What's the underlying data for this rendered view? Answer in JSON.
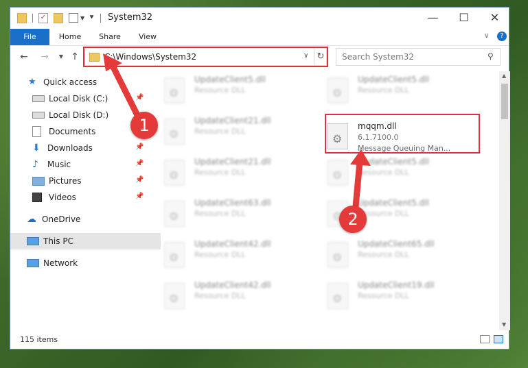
{
  "window": {
    "title": "System32",
    "tabs": [
      "File",
      "Home",
      "Share",
      "View"
    ]
  },
  "address": {
    "path": "C:\\Windows\\System32",
    "search_placeholder": "Search System32"
  },
  "nav": {
    "items": [
      {
        "label": "Quick access",
        "icon": "star-icon"
      },
      {
        "label": "Local Disk (C:)",
        "icon": "drive-icon"
      },
      {
        "label": "Local Disk (D:)",
        "icon": "drive-icon"
      },
      {
        "label": "Documents",
        "icon": "documents-icon"
      },
      {
        "label": "Downloads",
        "icon": "download-icon"
      },
      {
        "label": "Music",
        "icon": "music-icon"
      },
      {
        "label": "Pictures",
        "icon": "pictures-icon"
      },
      {
        "label": "Videos",
        "icon": "videos-icon"
      },
      {
        "label": "OneDrive",
        "icon": "cloud-icon"
      },
      {
        "label": "This PC",
        "icon": "computer-icon"
      },
      {
        "label": "Network",
        "icon": "network-icon"
      }
    ]
  },
  "files": {
    "left": [
      {
        "name": "UpdateClient5.dll",
        "type": "Resource DLL"
      },
      {
        "name": "UpdateClient21.dll",
        "type": "Resource DLL"
      },
      {
        "name": "UpdateClient21.dll",
        "type": "Resource DLL"
      },
      {
        "name": "UpdateClient63.dll",
        "type": "Resource DLL"
      },
      {
        "name": "UpdateClient42.dll",
        "type": "Resource DLL"
      },
      {
        "name": "UpdateClient42.dll",
        "type": "Resource DLL"
      }
    ],
    "right": [
      {
        "name": "UpdateClient5.dll",
        "type": "Resource DLL"
      },
      {
        "name": "UpdateClient5.dll",
        "type": "Resource DLL"
      },
      {
        "name": "UpdateClient5.dll",
        "type": "Resource DLL"
      },
      {
        "name": "UpdateClient65.dll",
        "type": "Resource DLL"
      },
      {
        "name": "UpdateClient19.dll",
        "type": "Resource DLL"
      }
    ],
    "selected": {
      "name": "mqqm.dll",
      "version": "6.1.7100.0",
      "description": "Message Queuing Man..."
    }
  },
  "status": {
    "item_count": "115 items"
  },
  "callouts": [
    "1",
    "2"
  ],
  "colors": {
    "accent": "#1a6fc9",
    "highlight": "#e0303a"
  }
}
